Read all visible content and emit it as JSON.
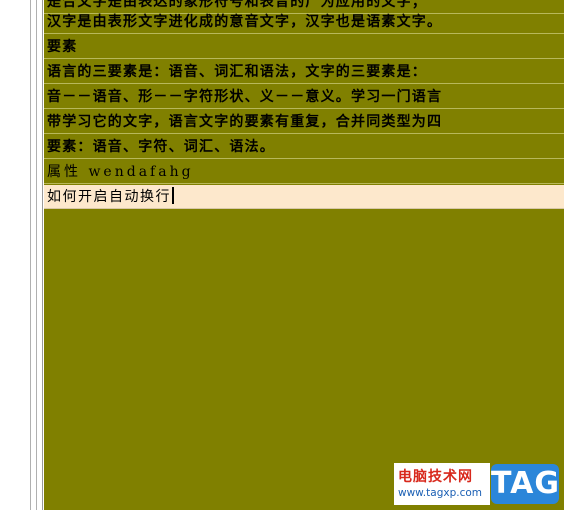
{
  "editor": {
    "lines": [
      "是合文字是由表达的象形符号和表音的广为应用的文字；",
      "汉字是由表形文字进化成的意音文字，汉字也是语素文字。",
      "要素",
      "语言的三要素是：语音、词汇和语法，文字的三要素是：",
      "音－－语音、形－－字符形状、义－－意义。学习一门语言",
      "带学习它的文字，语言文字的要素有重复，合并同类型为四",
      "要素：语音、字符、词汇、语法。",
      "属性 wendafahg",
      "如何开启自动换行"
    ],
    "colors": {
      "background": "#808000",
      "current_line": "#fde8cc"
    }
  },
  "watermark": {
    "site_name": "电脑技术网",
    "url": "www.tagxp.com",
    "tag": "TAG"
  }
}
